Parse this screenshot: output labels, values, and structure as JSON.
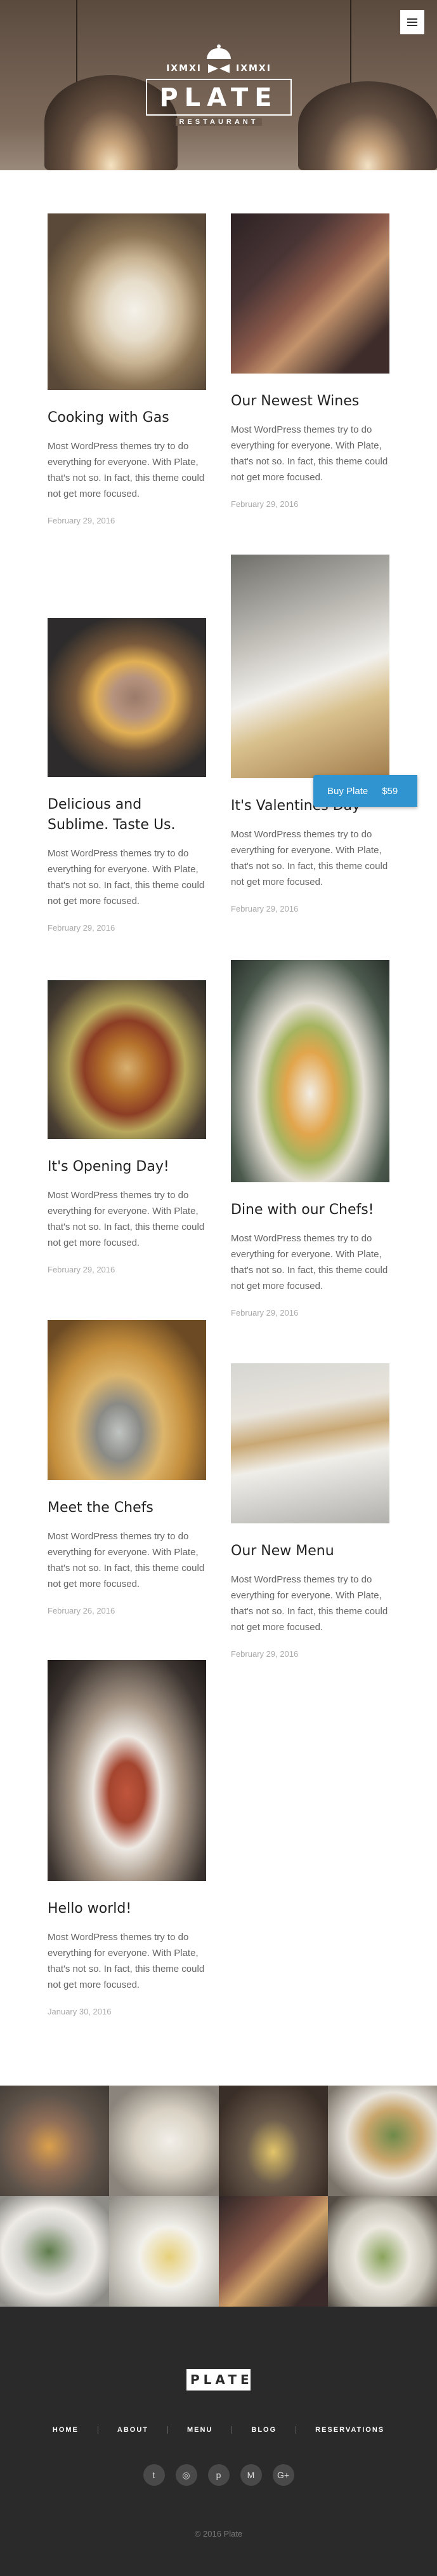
{
  "site": {
    "name": "PLATE",
    "tagline": "RESTAURANT",
    "est_left": "IXMXI",
    "est_right": "IXMXI"
  },
  "menu_icon": "hamburger-icon",
  "posts": [
    {
      "title": "Cooking with Gas",
      "excerpt": "Most WordPress themes try to do everything for everyone. With Plate, that's not so. In fact, this theme could not get more focused.",
      "date": "February 29, 2016"
    },
    {
      "title": "Our Newest Wines",
      "excerpt": "Most WordPress themes try to do everything for everyone. With Plate, that's not so. In fact, this theme could not get more focused.",
      "date": "February 29, 2016"
    },
    {
      "title": "Delicious and Sublime. Taste Us.",
      "excerpt": "Most WordPress themes try to do everything for everyone. With Plate, that's not so. In fact, this theme could not get more focused.",
      "date": "February 29, 2016"
    },
    {
      "title": "It's Valentines Day",
      "excerpt": "Most WordPress themes try to do everything for everyone. With Plate, that's not so. In fact, this theme could not get more focused.",
      "date": "February 29, 2016"
    },
    {
      "title": "It's Opening Day!",
      "excerpt": "Most WordPress themes try to do everything for everyone. With Plate, that's not so. In fact, this theme could not get more focused.",
      "date": "February 29, 2016"
    },
    {
      "title": "Dine with our Chefs!",
      "excerpt": "Most WordPress themes try to do everything for everyone. With Plate, that's not so. In fact, this theme could not get more focused.",
      "date": "February 29, 2016"
    },
    {
      "title": "Meet the Chefs",
      "excerpt": "Most WordPress themes try to do everything for everyone. With Plate, that's not so. In fact, this theme could not get more focused.",
      "date": "February 26, 2016"
    },
    {
      "title": "Our New Menu",
      "excerpt": "Most WordPress themes try to do everything for everyone. With Plate, that's not so. In fact, this theme could not get more focused.",
      "date": "February 29, 2016"
    },
    {
      "title": "Hello world!",
      "excerpt": "Most WordPress themes try to do everything for everyone. With Plate, that's not so. In fact, this theme could not get more focused.",
      "date": "January 30, 2016"
    }
  ],
  "buy_button": {
    "label": "Buy Plate",
    "price": "$59",
    "color": "#2f94cf"
  },
  "footer": {
    "logo": "PLATE",
    "nav": [
      "HOME",
      "ABOUT",
      "MENU",
      "BLOG",
      "RESERVATIONS"
    ],
    "social": [
      {
        "icon": "twitter-icon",
        "glyph": "t"
      },
      {
        "icon": "instagram-icon",
        "glyph": "◎"
      },
      {
        "icon": "pinterest-icon",
        "glyph": "p"
      },
      {
        "icon": "medium-icon",
        "glyph": "M"
      },
      {
        "icon": "google-plus-icon",
        "glyph": "G+"
      }
    ],
    "copyright": "© 2016 Plate"
  }
}
